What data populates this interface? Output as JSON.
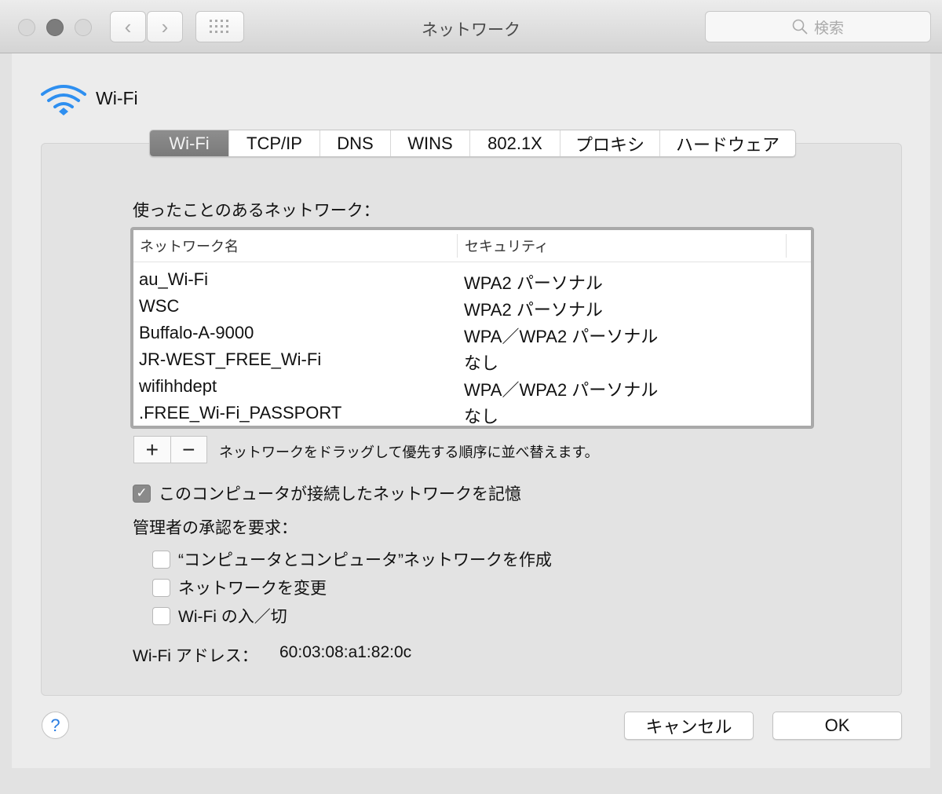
{
  "window": {
    "title": "ネットワーク",
    "search_placeholder": "検索"
  },
  "icons": {
    "wifi": "wifi-icon",
    "back": "chevron-left-icon",
    "forward": "chevron-right-icon",
    "grid": "grid-icon",
    "search": "search-icon",
    "help": "help-icon"
  },
  "colors": {
    "accent": "#2a7de1",
    "active_tab": "#858585"
  },
  "header": {
    "title": "Wi-Fi"
  },
  "tabs": [
    {
      "label": "Wi-Fi",
      "active": true
    },
    {
      "label": "TCP/IP"
    },
    {
      "label": "DNS"
    },
    {
      "label": "WINS"
    },
    {
      "label": "802.1X"
    },
    {
      "label": "プロキシ"
    },
    {
      "label": "ハードウェア"
    }
  ],
  "networks": {
    "label": "使ったことのあるネットワーク：",
    "columns": [
      "ネットワーク名",
      "セキュリティ"
    ],
    "rows": [
      [
        "au_Wi-Fi",
        "WPA2 パーソナル"
      ],
      [
        "WSC",
        "WPA2 パーソナル"
      ],
      [
        "Buffalo-A-9000",
        "WPA／WPA2 パーソナル"
      ],
      [
        "JR-WEST_FREE_Wi-Fi",
        "なし"
      ],
      [
        "wifihhdept",
        "WPA／WPA2 パーソナル"
      ],
      [
        ".FREE_Wi-Fi_PASSPORT",
        "なし"
      ]
    ],
    "add": "+",
    "remove": "−",
    "hint": "ネットワークをドラッグして優先する順序に並べ替えます。"
  },
  "remember": {
    "label": "このコンピュータが接続したネットワークを記憶",
    "checked": true
  },
  "admin": {
    "label": "管理者の承認を要求：",
    "options": [
      {
        "label": "“コンピュータとコンピュータ”ネットワークを作成",
        "checked": false
      },
      {
        "label": "ネットワークを変更",
        "checked": false
      },
      {
        "label": "Wi-Fi の入／切",
        "checked": false
      }
    ]
  },
  "address": {
    "label": "Wi-Fi アドレス：",
    "value": "60:03:08:a1:82:0c"
  },
  "buttons": {
    "help": "?",
    "cancel": "キャンセル",
    "ok": "OK"
  }
}
